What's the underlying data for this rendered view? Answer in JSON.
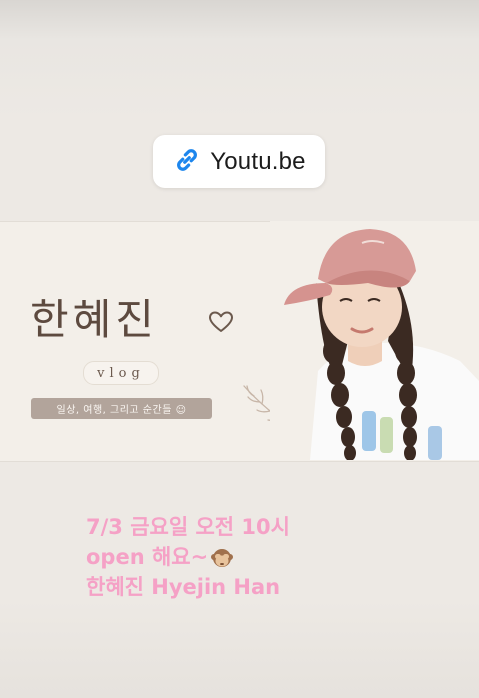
{
  "link_sticker": {
    "label": "Youtu.be",
    "icon": "link-icon",
    "icon_color": "#1d86ed"
  },
  "banner": {
    "channel_name": "한혜진",
    "subtitle": "vlog",
    "tagline": "일상, 여행, 그리고 순간들 ☺"
  },
  "caption": {
    "line1": "7/3 금요일 오전 10시",
    "line2": "open 해요~",
    "line2_emoji": "see-no-evil-monkey-icon",
    "line3": "한혜진 Hyejin Han",
    "color": "#f5a1c6"
  }
}
